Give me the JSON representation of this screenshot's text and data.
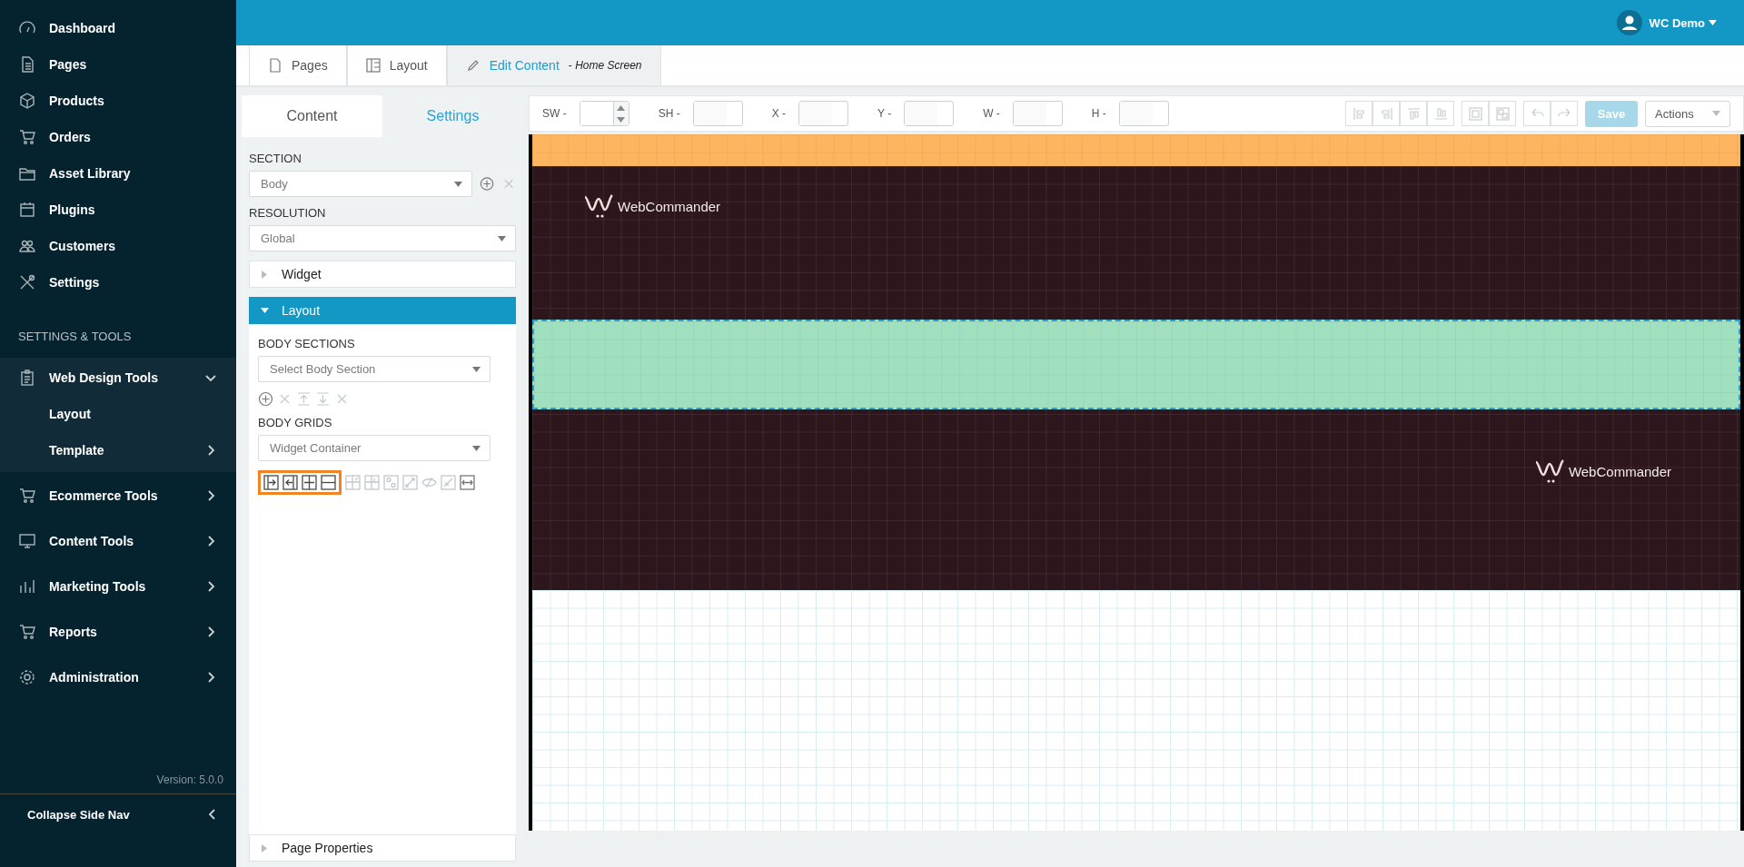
{
  "top_bar": {
    "user": "WC Demo"
  },
  "sidebar": {
    "items": [
      {
        "label": "Dashboard"
      },
      {
        "label": "Pages"
      },
      {
        "label": "Products"
      },
      {
        "label": "Orders"
      },
      {
        "label": "Asset Library"
      },
      {
        "label": "Plugins"
      },
      {
        "label": "Customers"
      },
      {
        "label": "Settings"
      }
    ],
    "section_title": "SETTINGS & TOOLS",
    "tools": [
      {
        "label": "Web Design Tools",
        "expanded": true,
        "children": [
          {
            "label": "Layout",
            "kind": "link"
          },
          {
            "label": "Template",
            "kind": "group",
            "expanded": false
          }
        ]
      },
      {
        "label": "Ecommerce Tools",
        "expanded": false
      },
      {
        "label": "Content Tools",
        "expanded": false
      },
      {
        "label": "Marketing Tools",
        "expanded": false
      },
      {
        "label": "Reports",
        "expanded": false
      },
      {
        "label": "Administration",
        "expanded": false
      }
    ],
    "version": "Version: 5.0.0",
    "collapse": "Collapse Side Nav"
  },
  "tabs": [
    {
      "label": "Pages",
      "selected": false
    },
    {
      "label": "Layout",
      "selected": false
    },
    {
      "label": "Edit Content",
      "suffix": "- *Home Screen*",
      "selected": true
    }
  ],
  "panel": {
    "tabs": [
      {
        "label": "Content",
        "selected": false
      },
      {
        "label": "Settings",
        "selected": true
      }
    ],
    "section": {
      "label": "SECTION",
      "value": "Body"
    },
    "resolution": {
      "label": "RESOLUTION",
      "value": "Global"
    },
    "accordions": [
      {
        "label": "Widget",
        "expanded": false
      },
      {
        "label": "Layout",
        "expanded": true
      }
    ],
    "body_sections": {
      "label": "BODY SECTIONS",
      "placeholder": "Select Body Section",
      "tools": [
        {
          "disabled": false
        },
        {
          "disabled": true
        },
        {
          "disabled": true
        },
        {
          "disabled": true
        },
        {
          "disabled": true
        }
      ]
    },
    "body_grids": {
      "label": "BODY GRIDS",
      "value": "Widget Container",
      "tools": [
        {
          "highlighted": true,
          "disabled": false
        },
        {
          "highlighted": true,
          "disabled": false
        },
        {
          "highlighted": true,
          "disabled": false
        },
        {
          "highlighted": true,
          "disabled": false
        },
        {
          "highlighted": false,
          "disabled": true
        },
        {
          "highlighted": false,
          "disabled": true
        },
        {
          "highlighted": false,
          "disabled": true
        },
        {
          "highlighted": false,
          "disabled": true
        },
        {
          "highlighted": false,
          "disabled": true
        },
        {
          "highlighted": false,
          "disabled": true
        },
        {
          "highlighted": false,
          "disabled": false
        }
      ]
    },
    "page_properties": {
      "label": "Page Properties",
      "expanded": false
    }
  },
  "toolbar": {
    "fields": [
      {
        "label": "SW -",
        "disabled": false
      },
      {
        "label": "SH -",
        "disabled": true
      },
      {
        "label": "X -",
        "disabled": true
      },
      {
        "label": "Y -",
        "disabled": true
      },
      {
        "label": "W -",
        "disabled": true
      },
      {
        "label": "H -",
        "disabled": true
      }
    ],
    "save": {
      "label": "Save",
      "disabled": true
    },
    "actions": "Actions"
  },
  "canvas": {
    "logos": [
      "WebCommander",
      "WebCommander"
    ]
  }
}
